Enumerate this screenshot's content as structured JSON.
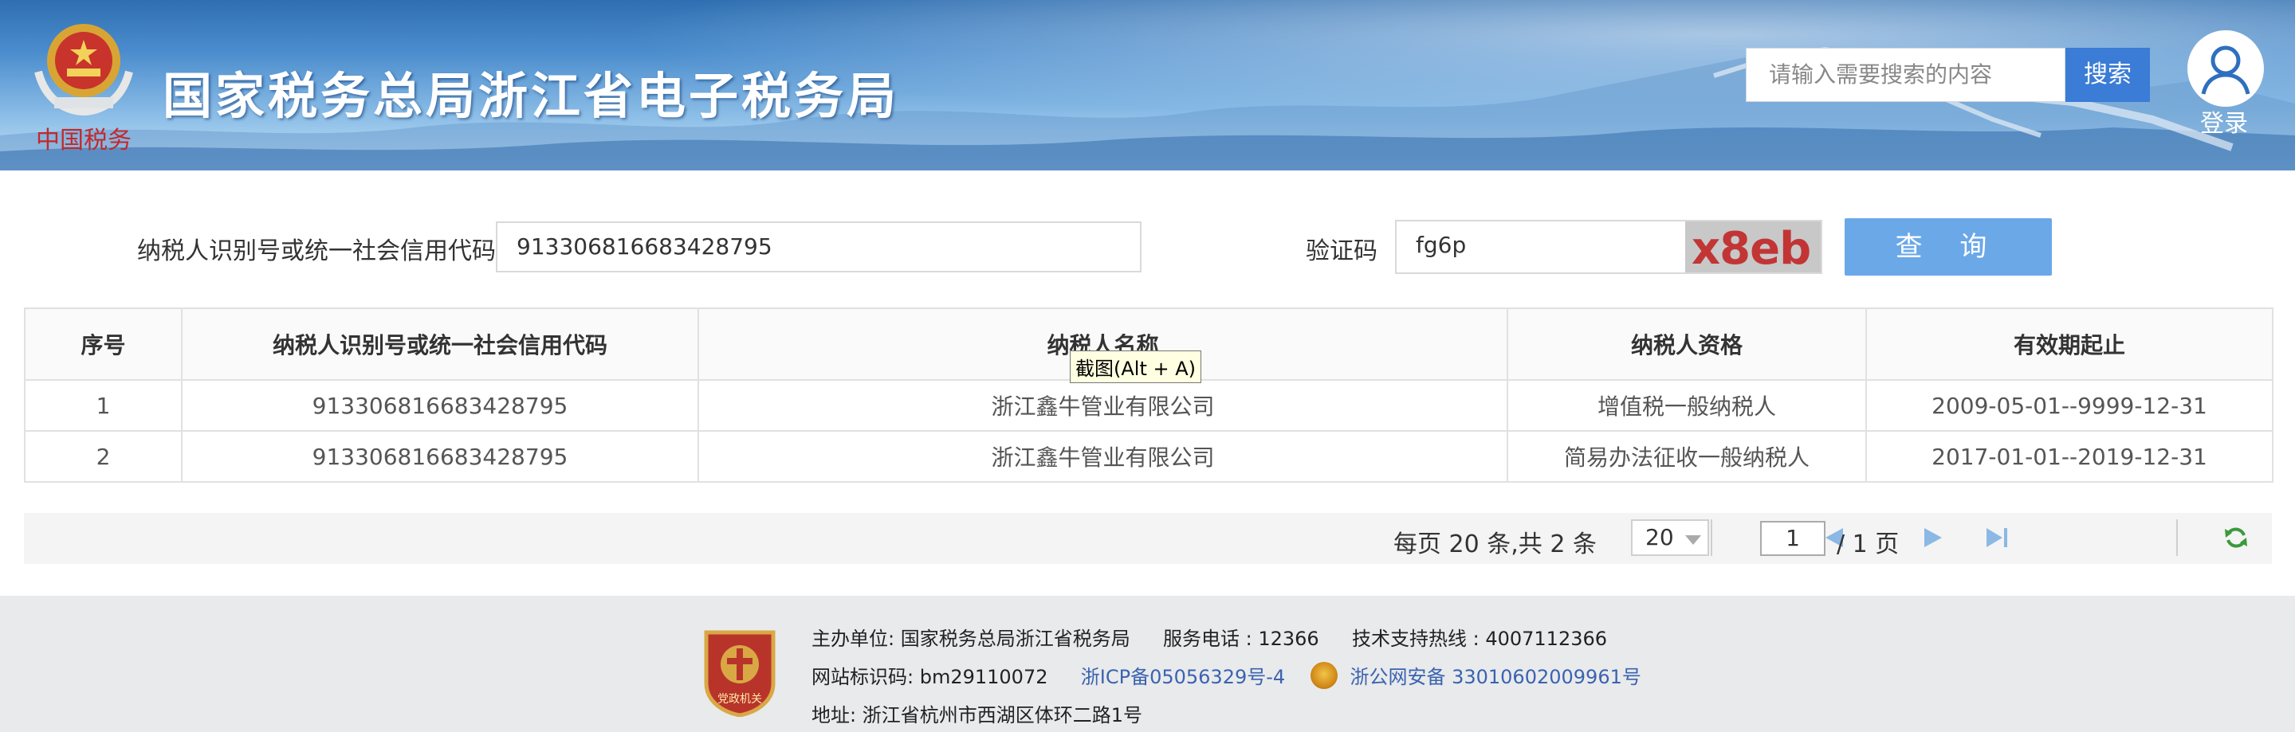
{
  "header": {
    "title": "国家税务总局浙江省电子税务局",
    "emblem_caption": "中国税务",
    "search_placeholder": "请输入需要搜索的内容",
    "search_button": "搜索",
    "login_label": "登录"
  },
  "query_form": {
    "taxid_label": "纳税人识别号或统一社会信用代码",
    "taxid_value": "913306816683428795",
    "captcha_label": "验证码",
    "captcha_value": "fg6p",
    "captcha_image_text": "x8eb",
    "query_button": "查 询"
  },
  "table": {
    "headers": [
      "序号",
      "纳税人识别号或统一社会信用代码",
      "纳税人名称",
      "纳税人资格",
      "有效期起止"
    ],
    "rows": [
      [
        "1",
        "913306816683428795",
        "浙江鑫牛管业有限公司",
        "增值税一般纳税人",
        "2009-05-01--9999-12-31"
      ],
      [
        "2",
        "913306816683428795",
        "浙江鑫牛管业有限公司",
        "简易办法征收一般纳税人",
        "2017-01-01--2019-12-31"
      ]
    ]
  },
  "tooltip": "截图(Alt + A)",
  "pager": {
    "info": "每页 20 条,共 2 条",
    "page_size": "20",
    "current_page": "1",
    "total_pages": "/ 1 页"
  },
  "footer": {
    "badge_text": "党政机关",
    "host": "主办单位: 国家税务总局浙江省税务局",
    "service_phone": "服务电话 : 12366",
    "support_hotline": "技术支持热线 : 4007112366",
    "site_code": "网站标识码: bm29110072",
    "icp": "浙ICP备05056329号-4",
    "police_record": "浙公网安备 33010602009961号",
    "address": "地址: 浙江省杭州市西湖区体环二路1号"
  },
  "colors": {
    "header_blue": "#3a7cd6",
    "query_button": "#6aa8e8",
    "link_blue": "#3a63b0",
    "captcha_red": "#c23535"
  }
}
